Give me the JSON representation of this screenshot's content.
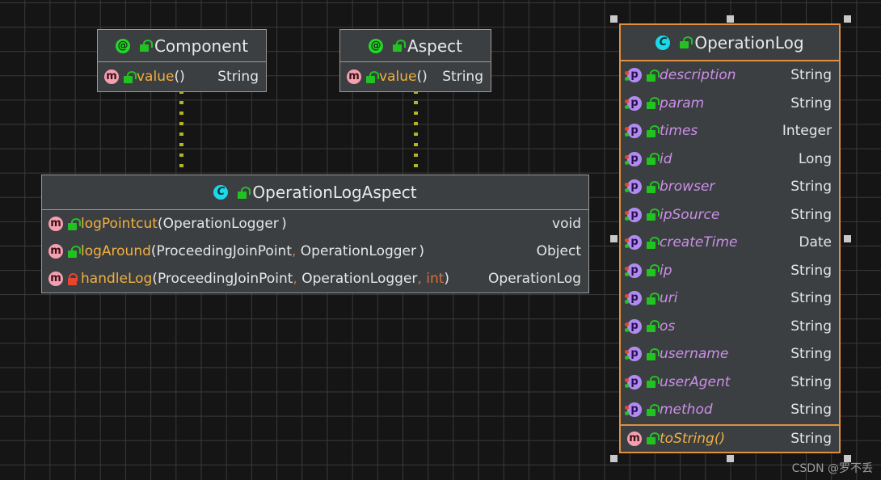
{
  "diagram": {
    "title": "UML class diagram",
    "background_color": "#151515",
    "grid_color": "#3a3a3a",
    "selection_color": "#e08f40"
  },
  "watermark": {
    "text": "CSDN @罗不丢"
  },
  "classes": [
    {
      "id": "component",
      "name": "Component",
      "stereotype": "annotation",
      "icon": "annotation-icon",
      "visibility_icon": "unlock-icon",
      "selected": false,
      "members": [
        {
          "icon": "method-icon",
          "visibility_icon": "unlock-icon",
          "name": "value",
          "parens": "()",
          "type": "String",
          "kind": "method"
        }
      ]
    },
    {
      "id": "aspect",
      "name": "Aspect",
      "stereotype": "annotation",
      "icon": "annotation-icon",
      "visibility_icon": "unlock-icon",
      "selected": false,
      "members": [
        {
          "icon": "method-icon",
          "visibility_icon": "unlock-icon",
          "name": "value",
          "parens": "()",
          "type": "String",
          "kind": "method"
        }
      ]
    },
    {
      "id": "operationlogaspect",
      "name": "OperationLogAspect",
      "stereotype": "class",
      "icon": "class-icon",
      "visibility_icon": "unlock-icon",
      "selected": false,
      "members": [
        {
          "icon": "method-icon",
          "visibility_icon": "unlock-icon",
          "kind": "method",
          "name": "logPointcut",
          "args": [
            "OperationLogger"
          ],
          "type": "void",
          "type_color": "#d4703a"
        },
        {
          "icon": "method-icon",
          "visibility_icon": "unlock-icon",
          "kind": "method",
          "name": "logAround",
          "args": [
            "ProceedingJoinPoint",
            "OperationLogger"
          ],
          "type": "Object",
          "type_color": "#e6e6e6"
        },
        {
          "icon": "method-icon",
          "visibility_icon": "lock-icon",
          "kind": "method",
          "name": "handleLog",
          "args": [
            "ProceedingJoinPoint",
            "OperationLogger",
            "int"
          ],
          "type": "OperationLog",
          "type_color": "#e6e6e6"
        }
      ]
    },
    {
      "id": "operationlog",
      "name": "OperationLog",
      "stereotype": "class",
      "icon": "class-icon",
      "visibility_icon": "unlock-icon",
      "selected": true,
      "fields": [
        {
          "icon": "property-icon",
          "visibility_icon": "unlock-icon",
          "name": "description",
          "type": "String"
        },
        {
          "icon": "property-icon",
          "visibility_icon": "unlock-icon",
          "name": "param",
          "type": "String"
        },
        {
          "icon": "property-icon",
          "visibility_icon": "unlock-icon",
          "name": "times",
          "type": "Integer"
        },
        {
          "icon": "property-icon",
          "visibility_icon": "unlock-icon",
          "name": "id",
          "type": "Long"
        },
        {
          "icon": "property-icon",
          "visibility_icon": "unlock-icon",
          "name": "browser",
          "type": "String"
        },
        {
          "icon": "property-icon",
          "visibility_icon": "unlock-icon",
          "name": "ipSource",
          "type": "String"
        },
        {
          "icon": "property-icon",
          "visibility_icon": "unlock-icon",
          "name": "createTime",
          "type": "Date"
        },
        {
          "icon": "property-icon",
          "visibility_icon": "unlock-icon",
          "name": "ip",
          "type": "String"
        },
        {
          "icon": "property-icon",
          "visibility_icon": "unlock-icon",
          "name": "uri",
          "type": "String"
        },
        {
          "icon": "property-icon",
          "visibility_icon": "unlock-icon",
          "name": "os",
          "type": "String"
        },
        {
          "icon": "property-icon",
          "visibility_icon": "unlock-icon",
          "name": "username",
          "type": "String"
        },
        {
          "icon": "property-icon",
          "visibility_icon": "unlock-icon",
          "name": "userAgent",
          "type": "String"
        },
        {
          "icon": "property-icon",
          "visibility_icon": "unlock-icon",
          "name": "method",
          "type": "String"
        }
      ],
      "methods": [
        {
          "icon": "method-icon",
          "visibility_icon": "unlock-icon",
          "name": "toString",
          "parens": "()",
          "type": "String"
        }
      ]
    }
  ],
  "connections": [
    {
      "from": "component",
      "to": "operationlogaspect",
      "style": "dotted",
      "color": "#b5b522"
    },
    {
      "from": "aspect",
      "to": "operationlogaspect",
      "style": "dotted",
      "color": "#b5b522"
    }
  ]
}
